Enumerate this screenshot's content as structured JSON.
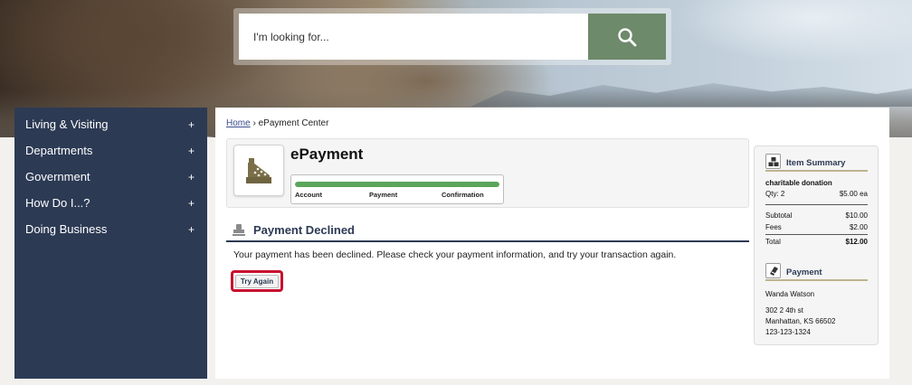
{
  "search": {
    "placeholder": "I'm looking for..."
  },
  "sidebar": {
    "items": [
      {
        "label": "Living & Visiting",
        "toggle": "+"
      },
      {
        "label": "Departments",
        "toggle": "+"
      },
      {
        "label": "Government",
        "toggle": "+"
      },
      {
        "label": "How Do I...?",
        "toggle": "+"
      },
      {
        "label": "Doing Business",
        "toggle": "+"
      }
    ]
  },
  "breadcrumb": {
    "home": "Home",
    "separator": "›",
    "current": "ePayment Center"
  },
  "epayment": {
    "title": "ePayment",
    "progress_percent": 100,
    "steps": [
      "Account",
      "Payment",
      "Confirmation"
    ]
  },
  "declined": {
    "title": "Payment Declined",
    "message": "Your payment has been declined. Please check your payment information, and try your transaction again.",
    "button_label": "Try Again"
  },
  "summary": {
    "item_heading": "Item Summary",
    "item_name": "charitable donation",
    "qty_label": "Qty:",
    "qty_value": "2",
    "unit_price": "$5.00 ea",
    "subtotal_label": "Subtotal",
    "subtotal_value": "$10.00",
    "fees_label": "Fees",
    "fees_value": "$2.00",
    "total_label": "Total",
    "total_value": "$12.00",
    "payment_heading": "Payment",
    "payer_name": "Wanda Watson",
    "address_line1": "302 2 4th st",
    "address_line2": "Manhattan, KS 66502",
    "phone": "123-123-1324"
  },
  "colors": {
    "sidebar_bg": "#2c3a54",
    "search_button": "#6d8a6a",
    "progress_fill": "#5aa55a",
    "highlight_border": "#c8102e",
    "summary_rule": "#bfb38f"
  },
  "icons": {
    "search": "search-icon",
    "epayment": "cash-register-icon",
    "declined": "stamp-icon",
    "item_summary": "boxes-icon",
    "payment": "card-icon"
  }
}
